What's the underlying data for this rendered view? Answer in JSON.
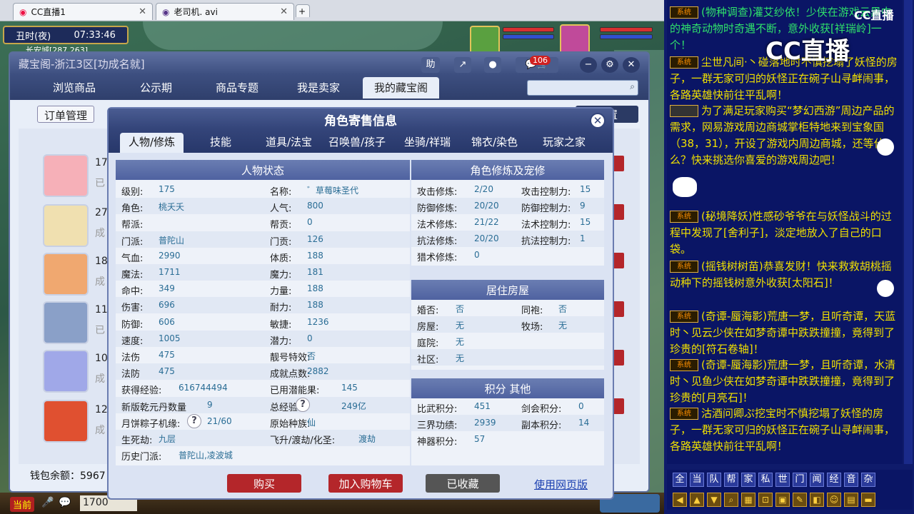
{
  "browser_tabs": [
    {
      "label": "CC直播1"
    },
    {
      "label": "老司机. avi"
    }
  ],
  "hud": {
    "period": "丑时(夜)",
    "clock": "07:33:46",
    "location": "长安城[287,263]"
  },
  "cbg": {
    "title": "藏宝阁-浙江3区[功成名就]",
    "nav": [
      "浏览商品",
      "公示期",
      "商品专题",
      "我是卖家",
      "我的藏宝阁"
    ],
    "btn_help": "助",
    "cart_count": "106",
    "order_btn": "订单管理",
    "settings_btn": "设置",
    "list_nums": [
      "17",
      "27",
      "18",
      "11",
      "10",
      "12"
    ],
    "list_subs": [
      "已",
      "成",
      "成",
      "已",
      "成",
      "成"
    ],
    "wallet": "钱包余额：5967"
  },
  "modal": {
    "title": "角色寄售信息",
    "tabs": [
      "人物/修炼",
      "技能",
      "道具/法宝",
      "召唤兽/孩子",
      "坐骑/祥瑞",
      "锦衣/染色",
      "玩家之家"
    ],
    "status_head": "人物状态",
    "status": [
      {
        "k1": "级别:",
        "v1": "175",
        "k2": "名称:",
        "v2": "゛草莓味圣代"
      },
      {
        "k1": "角色:",
        "v1": "桃夭夭",
        "k2": "人气:",
        "v2": "800"
      },
      {
        "k1": "帮派:",
        "v1": "",
        "k2": "帮贡:",
        "v2": "0"
      },
      {
        "k1": "门派:",
        "v1": "普陀山",
        "k2": "门贡:",
        "v2": "126"
      },
      {
        "k1": "气血:",
        "v1": "2990",
        "k2": "体质:",
        "v2": "188"
      },
      {
        "k1": "魔法:",
        "v1": "1711",
        "k2": "魔力:",
        "v2": "181"
      },
      {
        "k1": "命中:",
        "v1": "349",
        "k2": "力量:",
        "v2": "188"
      },
      {
        "k1": "伤害:",
        "v1": "696",
        "k2": "耐力:",
        "v2": "188"
      },
      {
        "k1": "防御:",
        "v1": "606",
        "k2": "敏捷:",
        "v2": "1236"
      },
      {
        "k1": "速度:",
        "v1": "1005",
        "k2": "潜力:",
        "v2": "0"
      },
      {
        "k1": "法伤",
        "v1": "475",
        "k2": "靓号特效:",
        "v2": "否"
      },
      {
        "k1": "法防",
        "v1": "475",
        "k2": "成就点数:",
        "v2": "2882"
      },
      {
        "k1": "获得经验:",
        "v1": "616744494",
        "k2": "已用潜能果:",
        "v2": "145"
      },
      {
        "k1": "新版乾元丹数量",
        "v1": "9",
        "k2": "总经验:",
        "v2": "249亿"
      },
      {
        "k1": "月饼粽子机缘:",
        "v1": "21/60",
        "k2": "原始种族:",
        "v2": "仙"
      },
      {
        "k1": "生死劫:",
        "v1": "九层",
        "k2": "飞升/渡劫/化圣:",
        "v2": "渡劫"
      },
      {
        "k1": "历史门派:",
        "v1": "普陀山,凌波城",
        "k2": "",
        "v2": ""
      }
    ],
    "cult_head": "角色修炼及宠修",
    "cult": [
      {
        "k1": "攻击修炼:",
        "v1": "2/20",
        "k2": "攻击控制力:",
        "v2": "15"
      },
      {
        "k1": "防御修炼:",
        "v1": "20/20",
        "k2": "防御控制力:",
        "v2": "9"
      },
      {
        "k1": "法术修炼:",
        "v1": "21/22",
        "k2": "法术控制力:",
        "v2": "15"
      },
      {
        "k1": "抗法修炼:",
        "v1": "20/20",
        "k2": "抗法控制力:",
        "v2": "1"
      },
      {
        "k1": "猎术修炼:",
        "v1": "0",
        "k2": "",
        "v2": ""
      }
    ],
    "house_head": "居住房屋",
    "house": [
      {
        "k1": "婚否:",
        "v1": "否",
        "k2": "同袍:",
        "v2": "否"
      },
      {
        "k1": "房屋:",
        "v1": "无",
        "k2": "牧场:",
        "v2": "无"
      },
      {
        "k1": "庭院:",
        "v1": "无",
        "k2": "",
        "v2": ""
      },
      {
        "k1": "社区:",
        "v1": "无",
        "k2": "",
        "v2": ""
      }
    ],
    "score_head": "积分 其他",
    "score": [
      {
        "k1": "比武积分:",
        "v1": "451",
        "k2": "剑会积分:",
        "v2": "0"
      },
      {
        "k1": "三界功绩:",
        "v1": "2939",
        "k2": "副本积分:",
        "v2": "14"
      },
      {
        "k1": "神器积分:",
        "v1": "57",
        "k2": "",
        "v2": ""
      }
    ],
    "buttons": {
      "buy": "购买",
      "cart": "加入购物车",
      "fav": "已收藏",
      "web": "使用网页版"
    }
  },
  "bottom": {
    "current": "当前",
    "money": "1700"
  },
  "chat": {
    "badge": "系统",
    "logo": "CC直播",
    "logo_small": "CC直播",
    "messages": [
      "(物种调查)灌艾纱依！少侠在游戏云黑中的神奇动物时奇遇不断，意外收获[祥瑞岭]一个！",
      "尘世凡间·丶碰落地时不慎挖塌了妖怪的房子，一群无家可归的妖怪正在碗子山寻衅闹事，各路英雄快前往平乱啊！",
      "为了满足玩家购买“梦幻西游”周边产品的需求，网易游戏周边商城掌柜特地来到宝象国（38，31），开设了游戏内周边商城，还等什么？快来挑选你喜爱的游戏周边吧！",
      "(秘境降妖)性感砂爷爷在与妖怪战斗的过程中发现了[舍利子]，淡定地放入了自己的口袋。",
      "(摇钱树树苗)恭喜发财！快来救救胡桃摇动种下的摇钱树意外收获[太阳石]！",
      "(奇谭-蜃海影)荒唐一梦，且听奇谭，天蓝时丶见云少侠在如梦奇谭中跌跌撞撞，竟得到了珍贵的[符石卷轴]！",
      "(奇谭-蜃海影)荒唐一梦，且听奇谭，水清时丶见鱼少侠在如梦奇谭中跌跌撞撞，竟得到了珍贵的[月亮石]！",
      "沽酒问卿ぷ挖宝时不慎挖塌了妖怪的房子，一群无家可归的妖怪正在碗子山寻衅闹事，各路英雄快前往平乱啊！"
    ],
    "channels": [
      "全",
      "当",
      "队",
      "帮",
      "家",
      "私",
      "世",
      "门",
      "闻",
      "经",
      "音",
      "杂"
    ]
  },
  "colors": {
    "chat_bg": "#0a1565",
    "accent": "#4f62a0",
    "buy": "#b4262a",
    "fav": "#555555"
  }
}
